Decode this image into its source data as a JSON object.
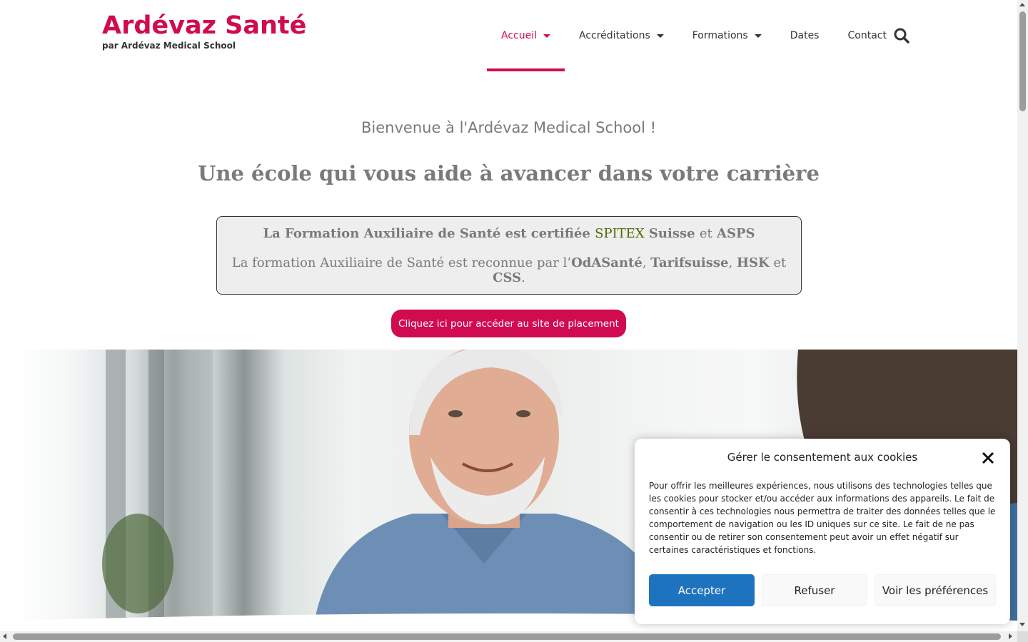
{
  "brand": {
    "name": "Ardévaz Santé",
    "subtitle": "par Ardévaz Medical School",
    "accent_color": "#d10b50"
  },
  "nav": {
    "items": [
      {
        "label": "Accueil",
        "has_dropdown": true,
        "active": true
      },
      {
        "label": "Accréditations",
        "has_dropdown": true,
        "active": false
      },
      {
        "label": "Formations",
        "has_dropdown": true,
        "active": false
      },
      {
        "label": "Dates",
        "has_dropdown": false,
        "active": false
      },
      {
        "label": "Contact",
        "has_dropdown": false,
        "active": false
      }
    ],
    "search_icon": "search-icon"
  },
  "hero": {
    "welcome": "Bienvenue à l'Ardévaz Medical School !",
    "tagline": "Une école qui vous aide à avancer dans votre carrière"
  },
  "certification": {
    "line1": {
      "prefix": "La Formation Auxiliaire de Santé est certifiée",
      "spitex": "SPITEX",
      "suisse": "Suisse",
      "and": "et",
      "asps": "ASPS"
    },
    "line2": {
      "prefix": "La formation Auxiliaire de Santé est  reconnue par l’",
      "odasante": "OdASanté",
      "comma1": ",",
      "tarifsuisse": "Tarifsuisse",
      "comma2": ",",
      "hsk": "HSK",
      "and": "et",
      "css": "CSS",
      "period": "."
    }
  },
  "cta": {
    "label": "Cliquez ici pour accéder au site de placement"
  },
  "cookie_dialog": {
    "title": "Gérer le consentement aux cookies",
    "text": "Pour offrir les meilleures expériences, nous utilisons des technologies telles que les cookies pour stocker et/ou accéder aux informations des appareils. Le fait de consentir à ces technologies nous permettra de traiter des données telles que le comportement de navigation ou les ID uniques sur ce site. Le fait de ne pas consentir ou de retirer son consentement peut avoir un effet négatif sur certaines caractéristiques et fonctions.",
    "accept": "Accepter",
    "refuse": "Refuser",
    "preferences": "Voir les préférences",
    "accept_color": "#1e73be"
  }
}
